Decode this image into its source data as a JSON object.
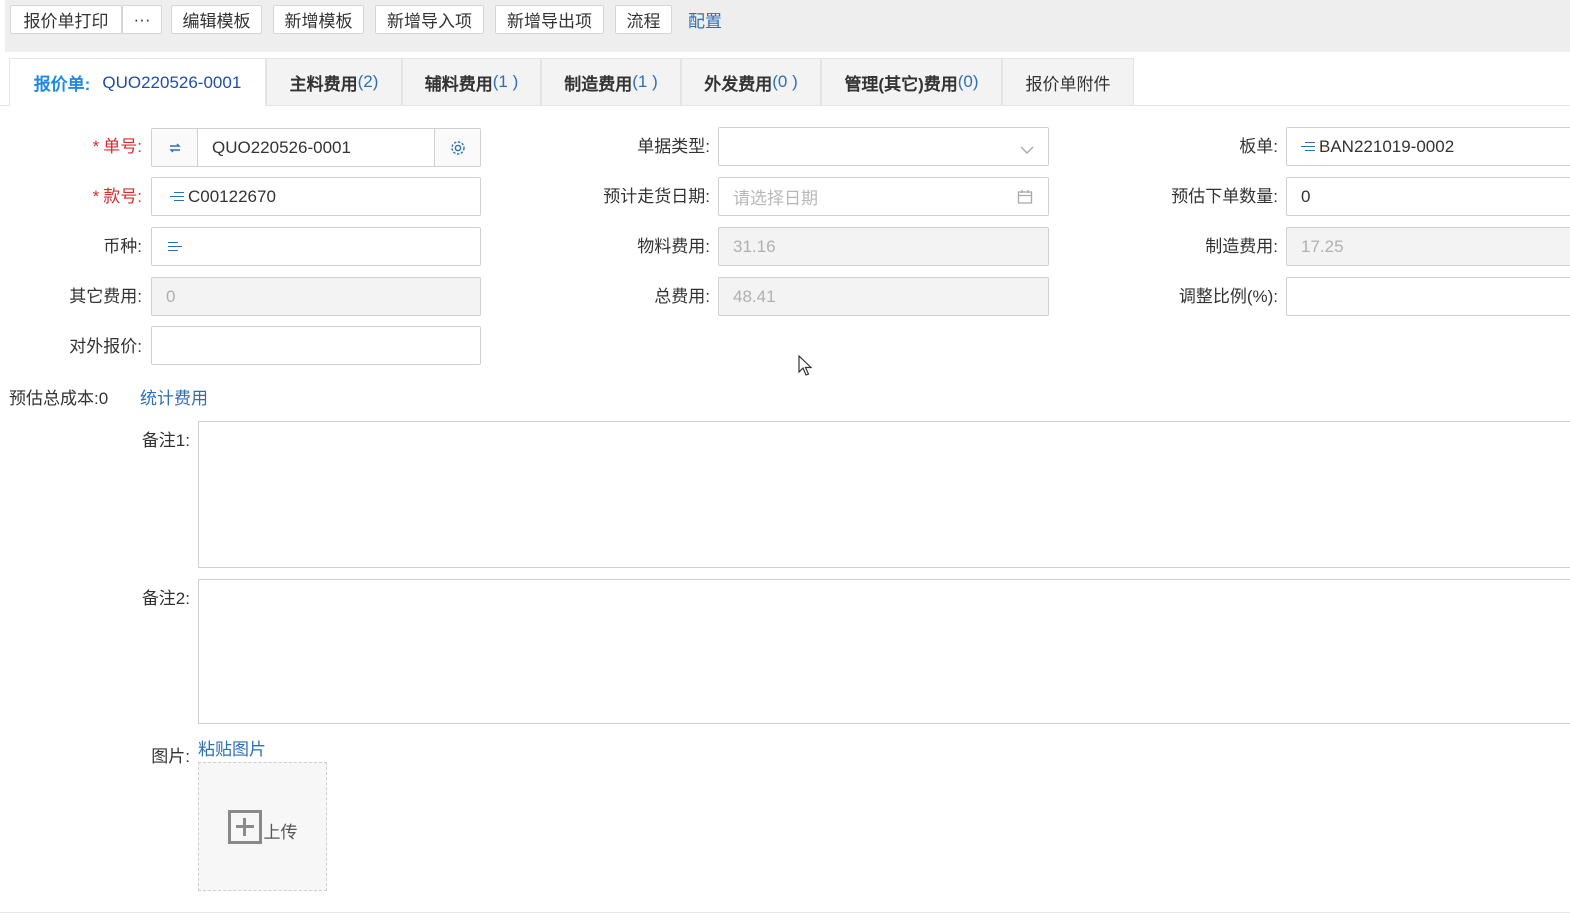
{
  "toolbar": {
    "print_label": "报价单打印",
    "more_label": "···",
    "edit_template_label": "编辑模板",
    "new_template_label": "新增模板",
    "new_import_label": "新增导入项",
    "new_export_label": "新增导出项",
    "flow_label": "流程",
    "config_label": "配置"
  },
  "tabs": {
    "quote_label": "报价单:",
    "quote_number": "QUO220526-0001",
    "main_material": "主料费用",
    "main_material_count": "(2)",
    "aux_material": "辅料费用",
    "aux_material_count": "(1 )",
    "manufacturing": "制造费用",
    "manufacturing_count": "(1 )",
    "outsourcing": "外发费用",
    "outsourcing_count": "(0 )",
    "management": "管理(其它)费用",
    "management_count": "(0)",
    "attachments": "报价单附件"
  },
  "form": {
    "order_no_label": "单号:",
    "order_no_value": "QUO220526-0001",
    "style_no_label": "款号:",
    "style_no_value": "C00122670",
    "currency_label": "币种:",
    "currency_value": "",
    "other_cost_label": "其它费用:",
    "other_cost_value": "0",
    "external_quote_label": "对外报价:",
    "external_quote_value": "",
    "doc_type_label": "单据类型:",
    "doc_type_value": "",
    "ship_date_label": "预计走货日期:",
    "ship_date_placeholder": "请选择日期",
    "material_cost_label": "物料费用:",
    "material_cost_value": "31.16",
    "total_cost_label": "总费用:",
    "total_cost_value": "48.41",
    "board_label": "板单:",
    "board_value": "BAN221019-0002",
    "est_order_qty_label": "预估下单数量:",
    "est_order_qty_value": "0",
    "manufacturing_cost_label": "制造费用:",
    "manufacturing_cost_value": "17.25",
    "adjust_ratio_label": "调整比例(%):",
    "adjust_ratio_value": ""
  },
  "summary": {
    "est_total_cost": "预估总成本:0",
    "calc_cost_link": "统计费用"
  },
  "remarks": {
    "remark1_label": "备注1:",
    "remark2_label": "备注2:"
  },
  "image": {
    "label": "图片:",
    "paste_link": "粘贴图片",
    "upload_label": "上传"
  },
  "colors": {
    "link": "#2d6fb5",
    "required": "#d32f2f",
    "active_tab": "#1e88e5"
  }
}
